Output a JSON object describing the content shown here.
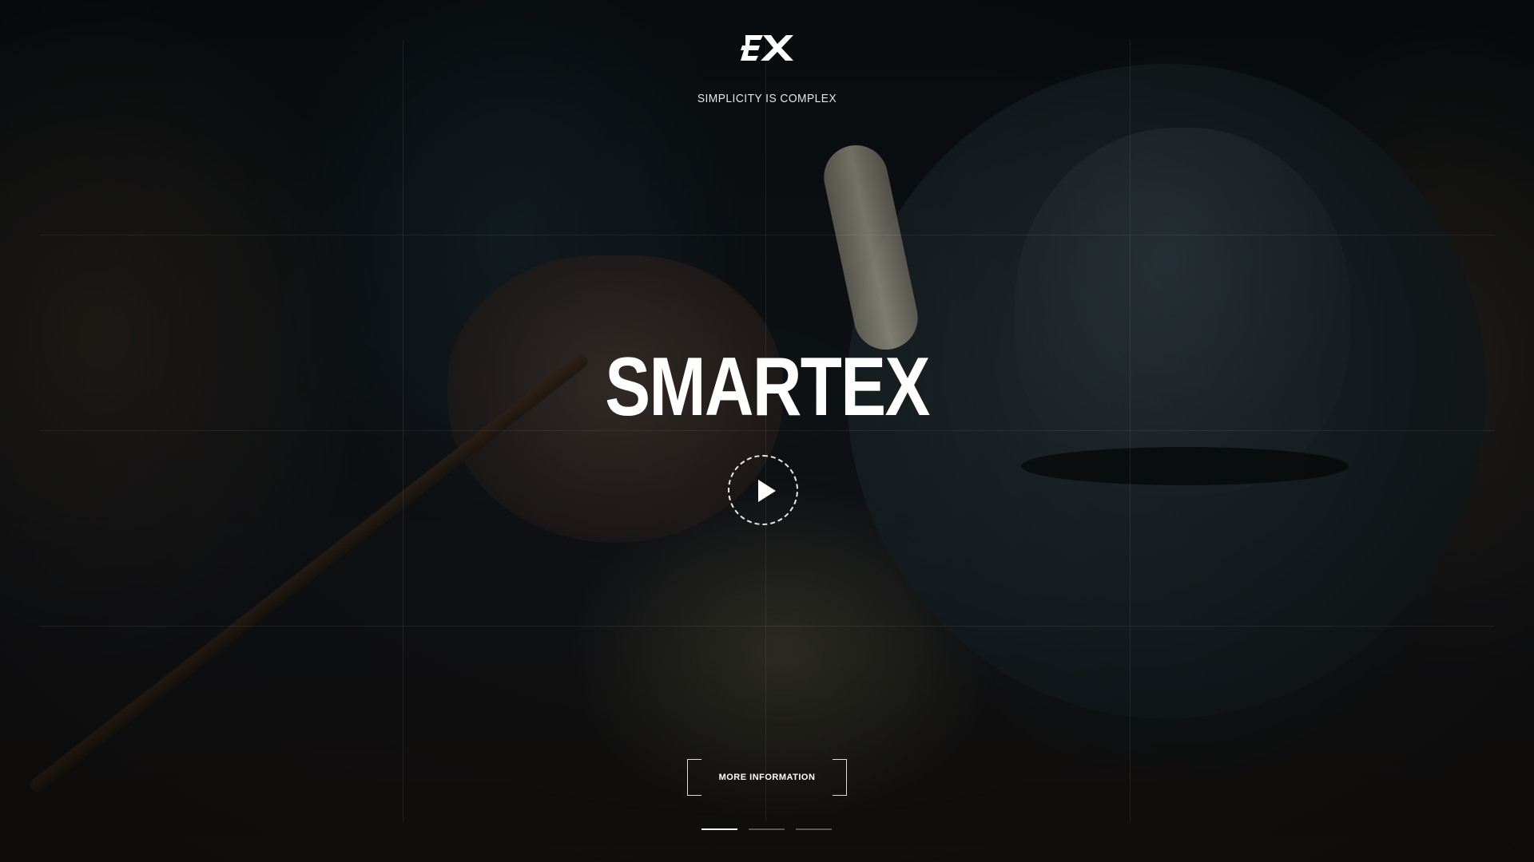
{
  "brand": {
    "logo_icon": "ex-logo-icon",
    "tagline": "SIMPLICITY IS COMPLEX",
    "title": "SMARTEX"
  },
  "hero": {
    "play_icon": "play-icon",
    "more_button_label": "MORE INFORMATION"
  },
  "slider": {
    "slides": 3,
    "active_index": 0
  },
  "colors": {
    "text": "#ffffff",
    "background": "#070b0e"
  }
}
